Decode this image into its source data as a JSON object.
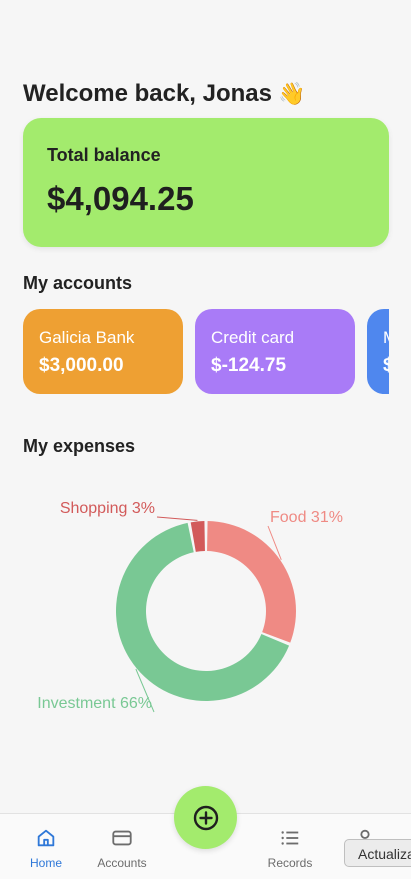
{
  "greeting": {
    "text": "Welcome back, Jonas",
    "emoji": "👋"
  },
  "balance": {
    "label": "Total balance",
    "value": "$4,094.25",
    "color": "#a3eb6d"
  },
  "accounts": {
    "title": "My accounts",
    "items": [
      {
        "name": "Galicia Bank",
        "balance": "$3,000.00",
        "color": "#eea033"
      },
      {
        "name": "Credit card",
        "balance": "$-124.75",
        "color": "#a97bf7"
      },
      {
        "name": "M",
        "balance": "$",
        "color": "#4f87ee"
      }
    ]
  },
  "expenses": {
    "title": "My expenses",
    "chart_data": {
      "type": "pie",
      "categories": [
        "Food",
        "Investment",
        "Shopping"
      ],
      "values": [
        31,
        66,
        3
      ],
      "labels": [
        "Food 31%",
        "Investment 66%",
        "Shopping 3%"
      ],
      "colors": [
        "#ef8a84",
        "#79c894",
        "#d25a5a"
      ],
      "donut": true
    }
  },
  "nav": {
    "items": [
      {
        "label": "Home",
        "icon": "home-icon",
        "active": true
      },
      {
        "label": "Accounts",
        "icon": "credit-card-icon",
        "active": false
      },
      {
        "label": "Records",
        "icon": "list-icon",
        "active": false
      },
      {
        "label": "",
        "icon": "user-icon",
        "active": false
      }
    ],
    "fab_icon": "plus-circle-icon",
    "fab_color": "#a3eb6d",
    "active_color": "#2f78d8"
  },
  "tooltip": {
    "text": "Actualizar"
  }
}
